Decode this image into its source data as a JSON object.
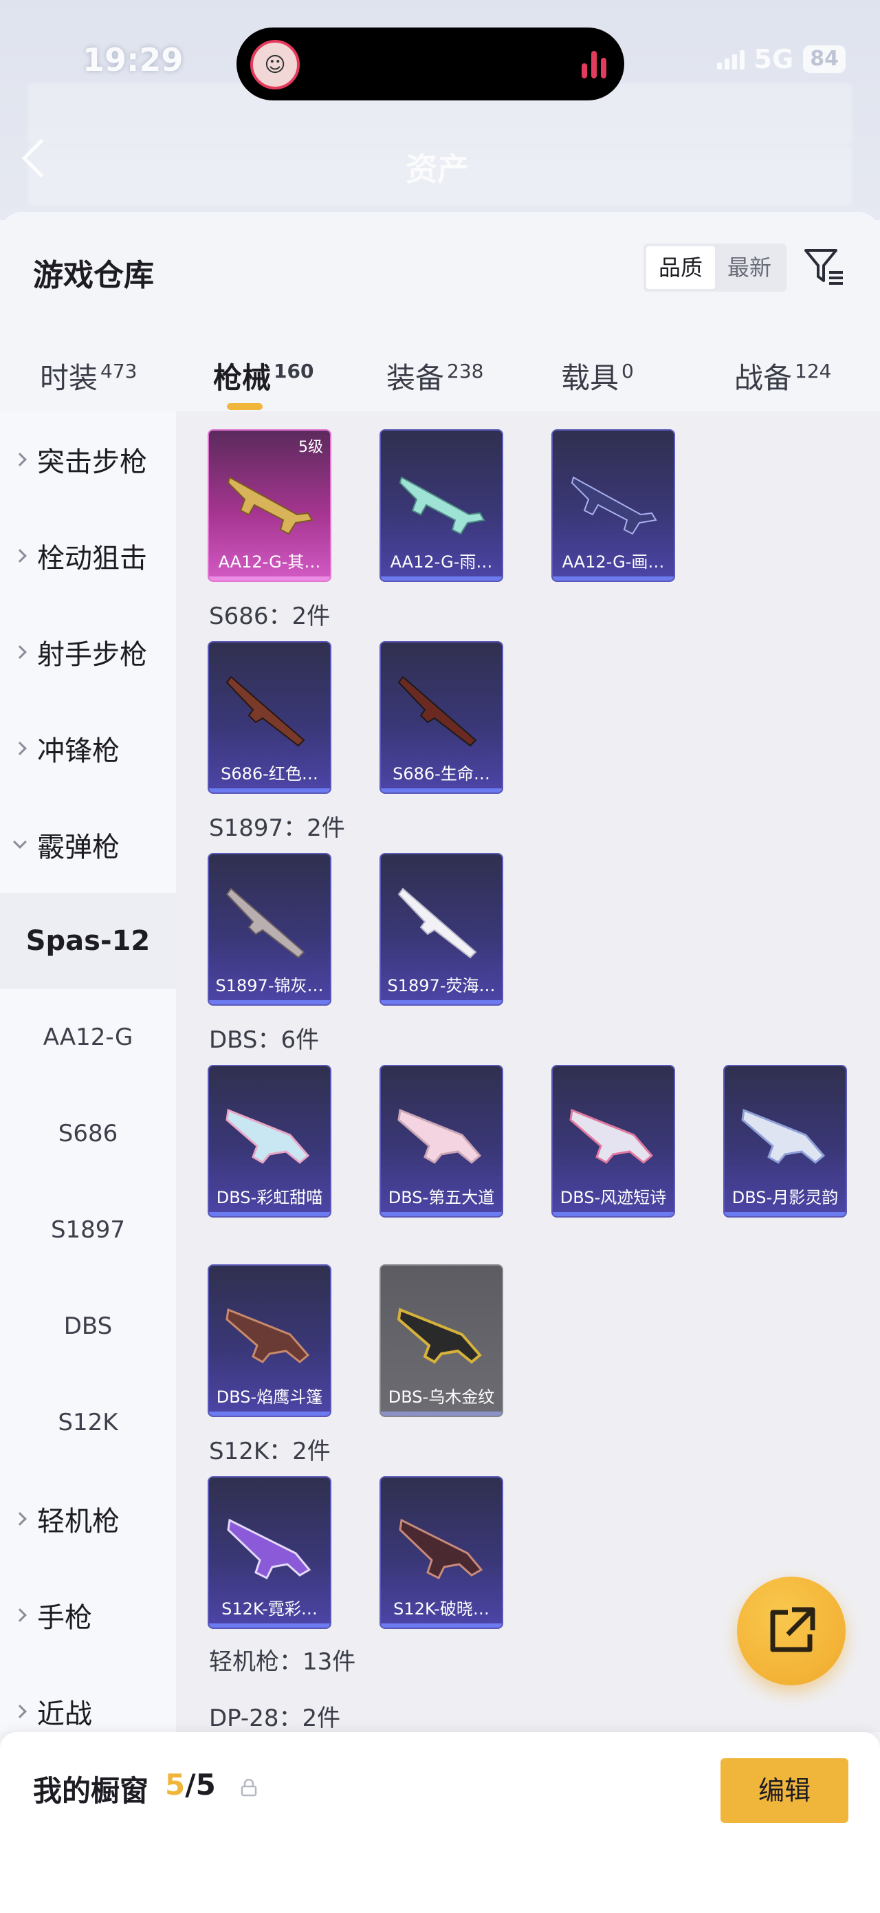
{
  "status_bar": {
    "time": "19:29",
    "network": "5G",
    "battery": "84"
  },
  "top": {
    "title": "资产"
  },
  "panel": {
    "title": "游戏仓库",
    "sort_options": [
      "品质",
      "最新"
    ],
    "active_sort": "品质"
  },
  "tabs": [
    {
      "label": "时装",
      "count": "473"
    },
    {
      "label": "枪械",
      "count": "160"
    },
    {
      "label": "装备",
      "count": "238"
    },
    {
      "label": "载具",
      "count": "0"
    },
    {
      "label": "战备",
      "count": "124"
    }
  ],
  "sidebar": {
    "items": [
      {
        "label": "突击步枪"
      },
      {
        "label": "栓动狙击"
      },
      {
        "label": "射手步枪"
      },
      {
        "label": "冲锋枪"
      },
      {
        "label": "霰弹枪"
      },
      {
        "label": "Spas-12"
      },
      {
        "label": "AA12-G"
      },
      {
        "label": "S686"
      },
      {
        "label": "S1897"
      },
      {
        "label": "DBS"
      },
      {
        "label": "S12K"
      },
      {
        "label": "轻机枪"
      },
      {
        "label": "手枪"
      },
      {
        "label": "近战"
      }
    ]
  },
  "content": {
    "cards": [
      {
        "name": "AA12-G-其…",
        "level": "5级"
      },
      {
        "name": "AA12-G-雨…"
      },
      {
        "name": "AA12-G-画…"
      },
      {
        "name": "S686-红色…"
      },
      {
        "name": "S686-生命…"
      },
      {
        "name": "S1897-锦灰…"
      },
      {
        "name": "S1897-荧海…"
      },
      {
        "name": "DBS-彩虹甜喵"
      },
      {
        "name": "DBS-第五大道"
      },
      {
        "name": "DBS-风迹短诗"
      },
      {
        "name": "DBS-月影灵韵"
      },
      {
        "name": "DBS-焰鹰斗篷"
      },
      {
        "name": "DBS-乌木金纹"
      },
      {
        "name": "S12K-霓彩…"
      },
      {
        "name": "S12K-破晓…"
      }
    ],
    "groups": [
      {
        "label": "S686：2件"
      },
      {
        "label": "S1897：2件"
      },
      {
        "label": "DBS：6件"
      },
      {
        "label": "S12K：2件"
      },
      {
        "label": "轻机枪：13件"
      },
      {
        "label": "DP-28：2件"
      }
    ]
  },
  "bottom_bar": {
    "label": "我的橱窗",
    "count_current": "5",
    "count_total": "/5",
    "edit_label": "编辑"
  },
  "colors": {
    "accent": "#f0b63c",
    "card_purple": "#3a3777",
    "card_pink": "#a53590"
  }
}
